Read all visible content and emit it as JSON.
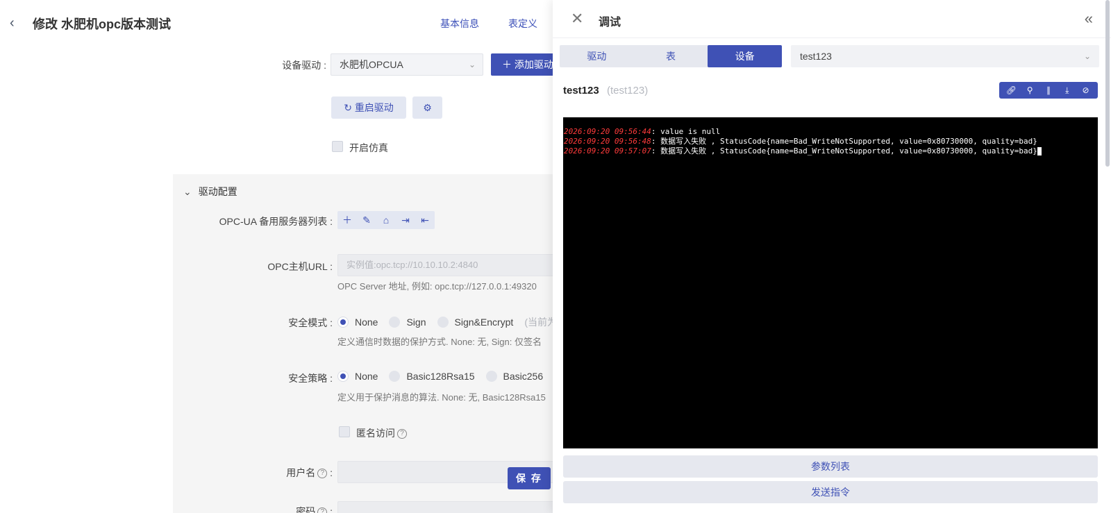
{
  "page": {
    "title": "修改 水肥机opc版本测试",
    "nav": [
      "基本信息",
      "表定义"
    ]
  },
  "form": {
    "driver_label": "设备驱动 :",
    "driver_value": "水肥机OPCUA",
    "add_driver_label": "添加驱动",
    "restart_label": "重启驱动",
    "simulate_label": "开启仿真",
    "section_title": "驱动配置",
    "backup_servers_label": "OPC-UA 备用服务器列表 :",
    "host_url_label": "OPC主机URL :",
    "host_url_placeholder": "实例值:opc.tcp://10.10.10.2:4840",
    "host_url_hint": "OPC Server 地址, 例如: opc.tcp://127.0.0.1:49320",
    "security_mode_label": "安全模式 :",
    "security_mode_options": [
      "None",
      "Sign",
      "Sign&Encrypt"
    ],
    "security_mode_suffix": "(当前为",
    "security_mode_hint": "定义通信时数据的保护方式. None: 无, Sign: 仅签名",
    "security_policy_label": "安全策略 :",
    "security_policy_options": [
      "None",
      "Basic128Rsa15",
      "Basic256"
    ],
    "security_policy_hint": "定义用于保护消息的算法. None: 无, Basic128Rsa15",
    "anonymous_label": "匿名访问",
    "username_label": "用户名",
    "password_label": "密码",
    "save_label": "保 存"
  },
  "drawer": {
    "title": "调试",
    "tabs": [
      "驱动",
      "表",
      "设备"
    ],
    "active_tab": "设备",
    "device_select_value": "test123",
    "device_name": "test123",
    "device_alias": "(test123)",
    "log": [
      {
        "time": "2026:09:20 09:56:44",
        "text": "value is null"
      },
      {
        "time": "2026:09:20 09:56:48",
        "text": "数据写入失败 , StatusCode{name=Bad_WriteNotSupported, value=0x80730000, quality=bad}"
      },
      {
        "time": "2026:09:20 09:57:07",
        "text": "数据写入失败 , StatusCode{name=Bad_WriteNotSupported, value=0x80730000, quality=bad}"
      }
    ],
    "params_button": "参数列表",
    "send_button": "发送指令"
  },
  "colors": {
    "primary": "#3f51b5",
    "terminal_bg": "#000000",
    "log_time": "#ff3b3b"
  }
}
